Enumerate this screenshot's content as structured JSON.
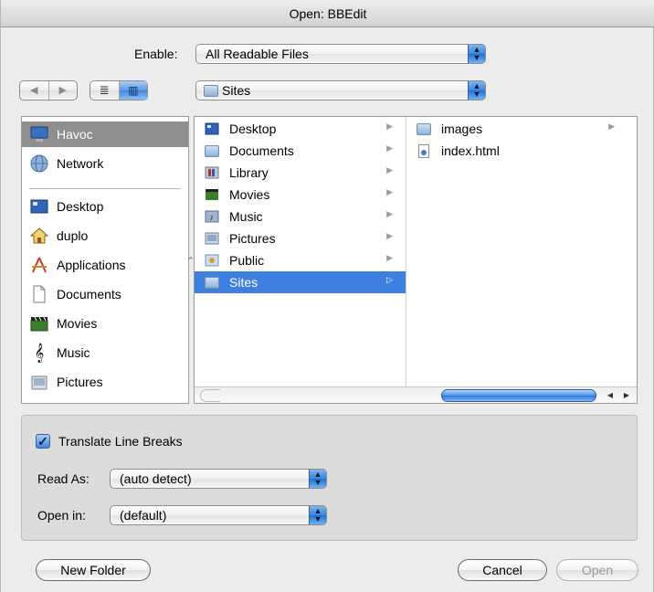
{
  "window": {
    "title": "Open: BBEdit"
  },
  "enable": {
    "label": "Enable:",
    "value": "All Readable Files"
  },
  "location": {
    "value": "Sites"
  },
  "view_modes": [
    "list-view",
    "column-view"
  ],
  "sidebar": {
    "devices": [
      {
        "label": "Havoc",
        "icon": "computer-icon",
        "selected": true
      },
      {
        "label": "Network",
        "icon": "network-icon",
        "selected": false
      }
    ],
    "places": [
      {
        "label": "Desktop",
        "icon": "desktop-icon"
      },
      {
        "label": "duplo",
        "icon": "home-icon"
      },
      {
        "label": "Applications",
        "icon": "applications-icon"
      },
      {
        "label": "Documents",
        "icon": "documents-icon"
      },
      {
        "label": "Movies",
        "icon": "movies-icon"
      },
      {
        "label": "Music",
        "icon": "music-icon"
      },
      {
        "label": "Pictures",
        "icon": "pictures-icon"
      }
    ]
  },
  "browser": {
    "column1": [
      {
        "label": "Desktop",
        "icon": "desktop-folder-icon"
      },
      {
        "label": "Documents",
        "icon": "documents-folder-icon"
      },
      {
        "label": "Library",
        "icon": "library-folder-icon"
      },
      {
        "label": "Movies",
        "icon": "movies-folder-icon"
      },
      {
        "label": "Music",
        "icon": "music-folder-icon"
      },
      {
        "label": "Pictures",
        "icon": "pictures-folder-icon"
      },
      {
        "label": "Public",
        "icon": "public-folder-icon"
      },
      {
        "label": "Sites",
        "icon": "sites-folder-icon",
        "selected": true
      }
    ],
    "column2": [
      {
        "label": "images",
        "icon": "folder-icon",
        "is_folder": true
      },
      {
        "label": "index.html",
        "icon": "html-file-icon",
        "is_folder": false
      }
    ]
  },
  "options": {
    "translate_line_breaks": {
      "label": "Translate Line Breaks",
      "checked": true
    },
    "read_as": {
      "label": "Read As:",
      "value": "(auto detect)"
    },
    "open_in": {
      "label": "Open in:",
      "value": "(default)"
    }
  },
  "buttons": {
    "new_folder": "New Folder",
    "cancel": "Cancel",
    "open": "Open"
  },
  "colors": {
    "selection": "#3d80df",
    "sidebar_selection": "#8e8e8e",
    "aqua_blue": "#3f87e0"
  }
}
